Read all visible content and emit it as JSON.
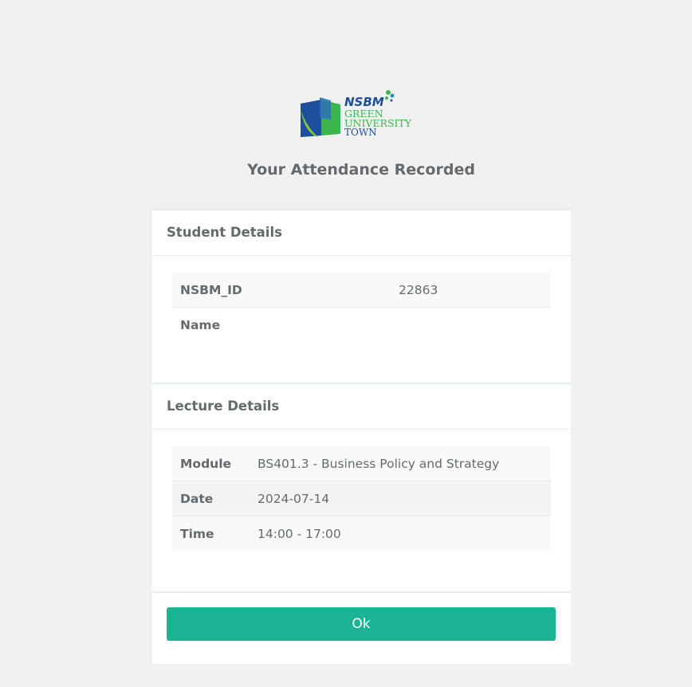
{
  "logo": {
    "brand": "NSBM",
    "line1": "GREEN",
    "line2": "UNIVERSITY",
    "line3": "TOWN"
  },
  "page_title": "Your Attendance Recorded",
  "student": {
    "header": "Student Details",
    "rows": [
      {
        "label": "NSBM_ID",
        "value": "22863"
      },
      {
        "label": "Name",
        "value": ""
      }
    ]
  },
  "lecture": {
    "header": "Lecture Details",
    "rows": [
      {
        "label": "Module",
        "value": "BS401.3 - Business Policy and Strategy"
      },
      {
        "label": "Date",
        "value": "2024-07-14"
      },
      {
        "label": "Time",
        "value": "14:00 - 17:00"
      }
    ]
  },
  "ok_label": "Ok",
  "colors": {
    "accent": "#1ab394",
    "logo_blue": "#1e4f9c",
    "logo_green": "#3cb54a"
  }
}
